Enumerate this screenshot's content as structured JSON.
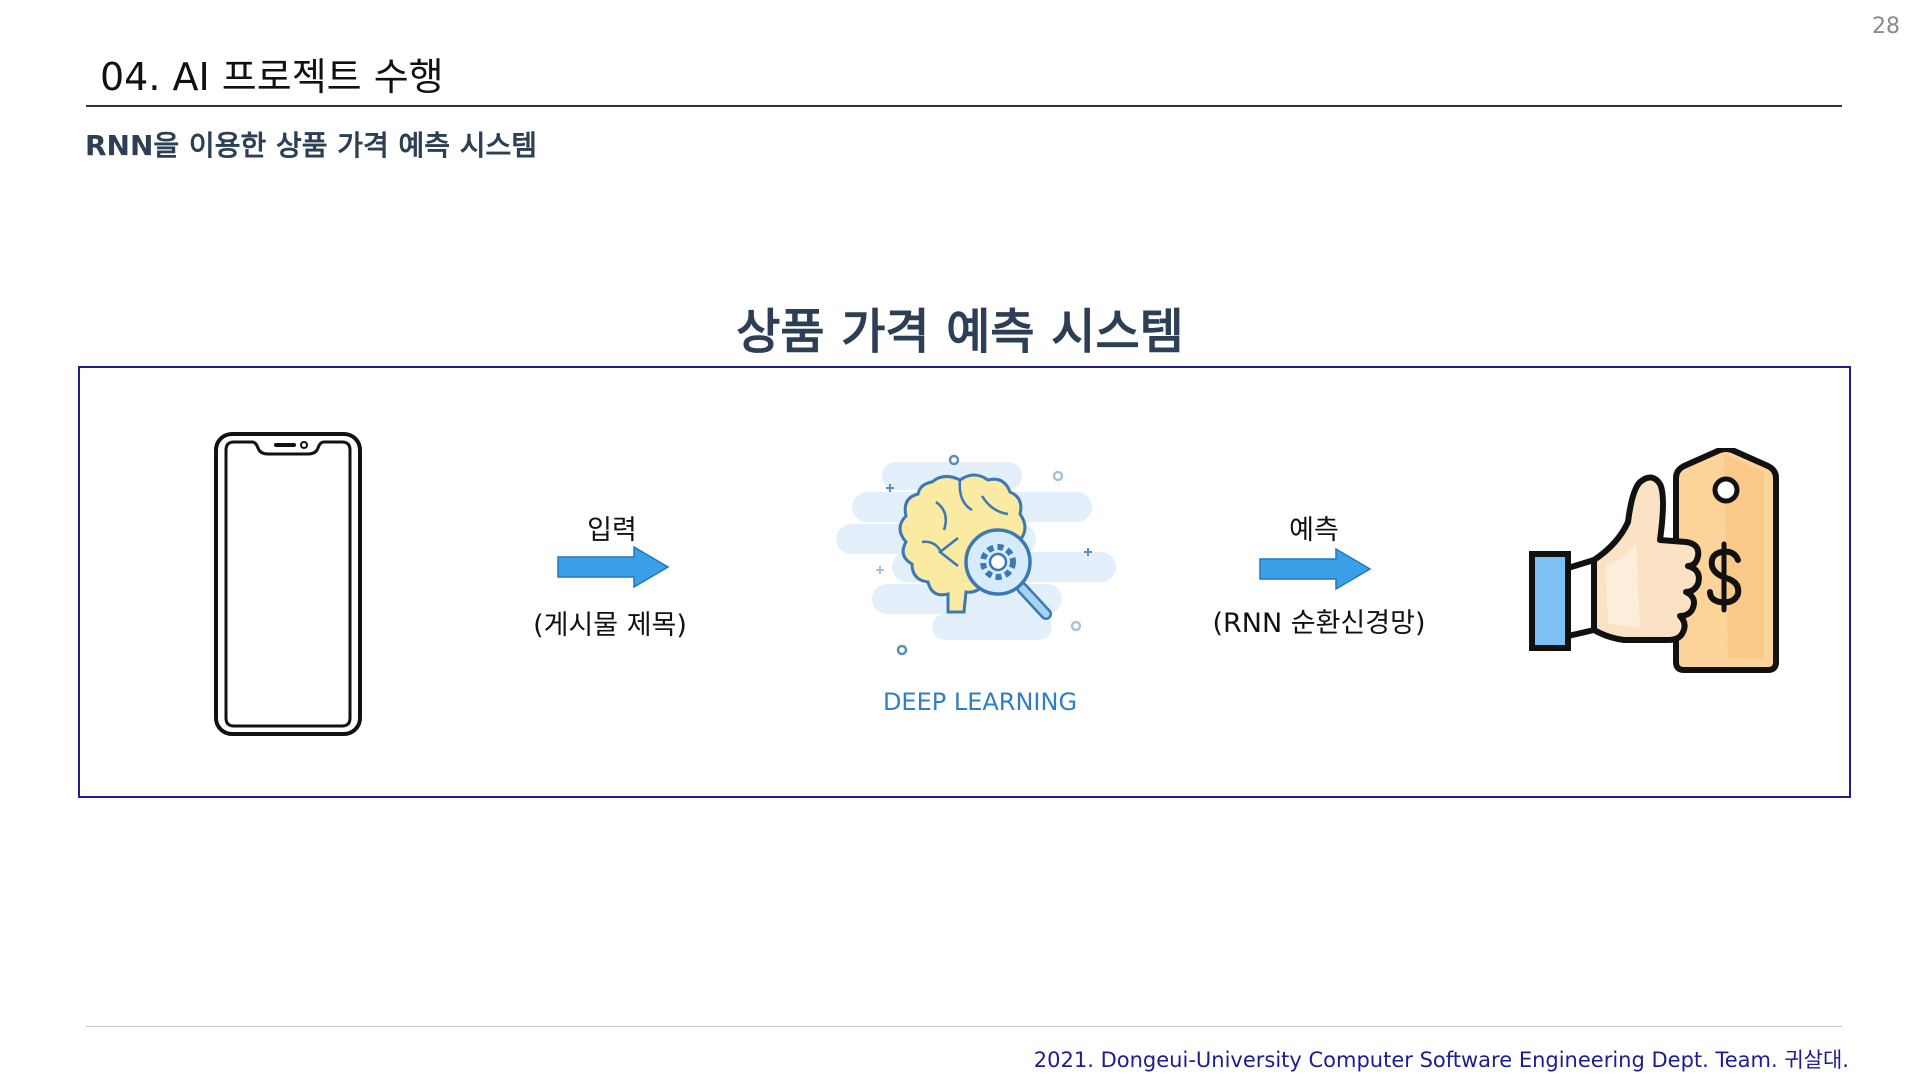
{
  "page_number": "28",
  "title": "04. AI 프로젝트 수행",
  "subtitle": "RNN을 이용한 상품 가격 예측 시스템",
  "diagram": {
    "heading": "상품 가격 예측 시스템",
    "input_label": "입력",
    "input_caption": "(게시물 제목)",
    "model_label": "DEEP LEARNING",
    "output_label": "예측",
    "output_caption": "(RNN 순환신경망)",
    "icons": [
      "smartphone-icon",
      "arrow-right-icon",
      "brain-search-icon",
      "arrow-right-icon",
      "thumbs-up-price-tag-icon"
    ],
    "colors": {
      "box_border": "#1f1f8a",
      "arrow": "#3a9fe6",
      "model_label": "#2f7fc2"
    }
  },
  "footer": "2021. Dongeui-University Computer Software Engineering Dept. Team. 귀살대."
}
